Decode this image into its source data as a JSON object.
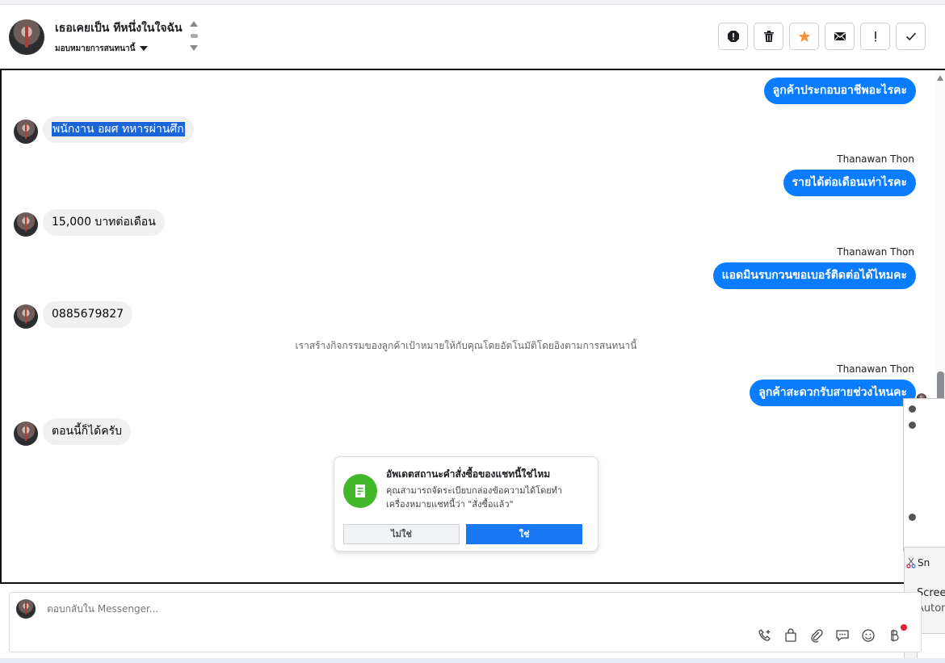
{
  "header": {
    "conversation_name": "เธอเคยเป็น ทีหนึ่งในใจฉัน",
    "assign_label": "มอบหมายการสนทนานี้",
    "tools": [
      {
        "name": "spam-icon"
      },
      {
        "name": "trash-icon"
      },
      {
        "name": "star-icon"
      },
      {
        "name": "mail-icon"
      },
      {
        "name": "exclamation-icon"
      },
      {
        "name": "check-icon"
      }
    ]
  },
  "messages": [
    {
      "dir": "out",
      "text": "ลูกค้าประกอบอาชีพอะไรคะ"
    },
    {
      "dir": "in",
      "text": "พนักงาน อผศ ทหารผ่านศึก",
      "selected": true
    },
    {
      "dir": "out",
      "sender": "Thanawan Thon",
      "text": "รายได้ต่อเดือนเท่าไรคะ"
    },
    {
      "dir": "in",
      "text": "15,000 บาทต่อเดือน"
    },
    {
      "dir": "out",
      "sender": "Thanawan Thon",
      "text": "แอดมินรบกวนขอเบอร์ติดต่อได้ไหมคะ"
    },
    {
      "dir": "in",
      "text": "0885679827"
    },
    {
      "dir": "out",
      "sender": "Thanawan Thon",
      "text": "ลูกค้าสะดวกรับสายช่วงไหนคะ"
    },
    {
      "dir": "in",
      "text": "ตอนนี้ก็ได้ครับ"
    }
  ],
  "system_message": "เราสร้างกิจกรรมของลูกค้าเป้าหมายให้กับคุณโดยอัตโนมัติโดยอิงตามการสนทนานี้",
  "popup": {
    "title": "อัพเดตสถานะคำสั่งซื้อของแชทนี้ใช่ไหม",
    "body": "คุณสามารถจัดระเบียบกล่องข้อความได้โดยทำเครื่องหมายแชทนี้ว่า \"สั่งซื้อแล้ว\"",
    "no_label": "ไม่ใช่",
    "yes_label": "ใช่"
  },
  "composer": {
    "placeholder": "ตอบกลับใน Messenger...",
    "tools": [
      "phone-plus-icon",
      "shopping-bag-icon",
      "paperclip-icon",
      "chat-bubble-icon",
      "emoji-icon",
      "baht-icon"
    ]
  },
  "overlay": {
    "notify_app": "Sn",
    "notify_line1": "Screen",
    "notify_line2": "Autom"
  },
  "colors": {
    "outgoing_bubble": "#0a7cff",
    "incoming_bubble": "#f0f0f0",
    "primary_button": "#1877f2",
    "popup_icon": "#42b72a",
    "star": "#f7923b"
  }
}
